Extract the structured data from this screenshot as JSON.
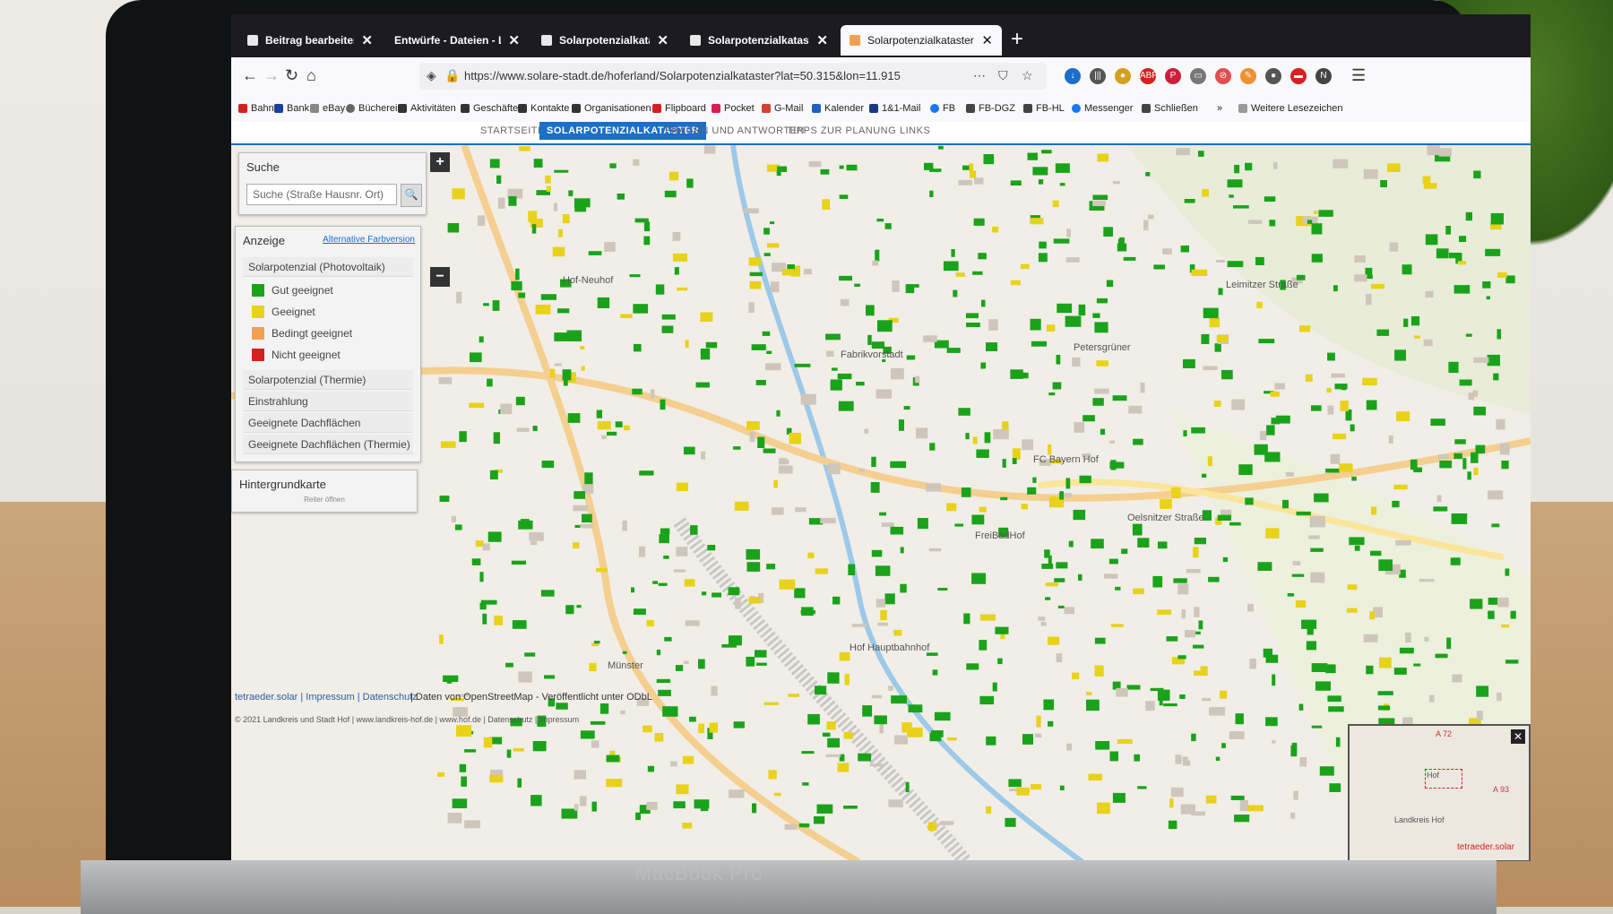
{
  "tabs": [
    {
      "label": "Beitrag bearbeiten ‹ hoferLand",
      "active": false
    },
    {
      "label": "Entwürfe - Dateien - Landkreis",
      "active": false
    },
    {
      "label": "Solarpotenzialkataster",
      "active": false
    },
    {
      "label": "Solarpotenzialkataster",
      "active": false
    },
    {
      "label": "Solarpotenzialkataster Hoferland",
      "active": true
    }
  ],
  "url": "https://www.solare-stadt.de/hoferland/Solarpotenzialkataster?lat=50.315&lon=11.915",
  "bookmarks": [
    "Bahn",
    "Bank",
    "eBay",
    "Bücherei",
    "Aktivitäten",
    "Geschäfte",
    "Kontakte",
    "Organisationen",
    "Flipboard",
    "Pocket",
    "G-Mail",
    "Kalender",
    "1&1-Mail",
    "FB",
    "FB-DGZ",
    "FB-HL",
    "Messenger",
    "Schließen"
  ],
  "bookmarks_more": "Weitere Lesezeichen",
  "site_nav": [
    "STARTSEITE",
    "SOLARPOTENZIALKATASTER",
    "FRAGEN UND ANTWORTEN",
    "TIPPS ZUR PLANUNG",
    "LINKS"
  ],
  "search": {
    "title": "Suche",
    "placeholder": "Suche (Straße Hausnr. Ort)"
  },
  "display": {
    "title": "Anzeige",
    "alt_link": "Alternative Farbversion",
    "layers": [
      "Solarpotenzial (Photovoltaik)",
      "Solarpotenzial (Thermie)",
      "Einstrahlung",
      "Geeignete Dachflächen (Photovoltaik)",
      "Geeignete Dachflächen (Thermie)"
    ],
    "legend": [
      {
        "label": "Gut geeignet",
        "color": "#1aa31a"
      },
      {
        "label": "Geeignet",
        "color": "#e8d21a"
      },
      {
        "label": "Bedingt geeignet",
        "color": "#f0a050"
      },
      {
        "label": "Nicht geeignet",
        "color": "#d62020"
      }
    ]
  },
  "basemap": {
    "title": "Hintergrundkarte",
    "sub": "Reiter öffnen"
  },
  "map_labels": [
    "Hof-Neuhof",
    "Fabrikvorstadt",
    "Petersgrüner",
    "Oelsnitzer Straße",
    "Hof Hauptbahnhof",
    "FC Bayern Hof",
    "FreiBadHof",
    "Leimitzer Straße",
    "Münster"
  ],
  "attribution": {
    "links": "tetraeder.solar | Impressum | Datenschutz",
    "osm": "| Daten von OpenStreetMap - Veröffentlicht unter ODbL"
  },
  "footer": "© 2021 Landkreis und Stadt Hof | www.landkreis-hof.de | www.hof.de | Datenschutz | Impressum",
  "minimap_labels": [
    "A 72",
    "Hof",
    "A 93",
    "Landkreis Hof"
  ],
  "brand": "tetraeder.solar",
  "device": "MacBook Pro",
  "colors": {
    "accent": "#1a6fc9",
    "good": "#1aa31a",
    "suitable": "#e8d21a"
  }
}
